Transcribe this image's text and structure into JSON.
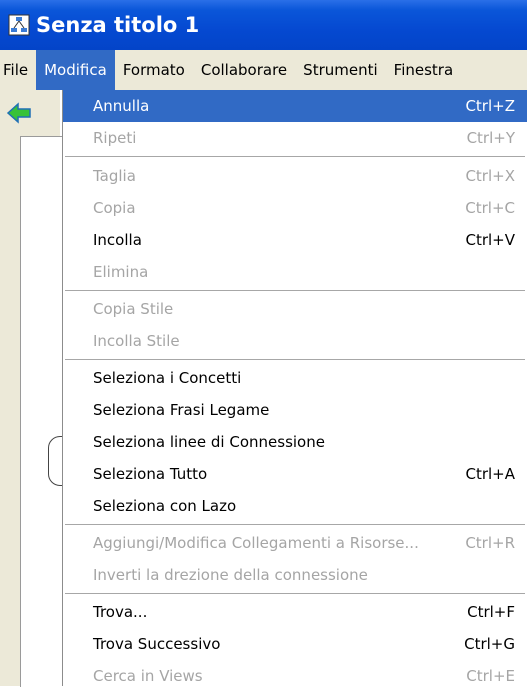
{
  "window": {
    "title": "Senza titolo 1"
  },
  "menubar": {
    "items": [
      "File",
      "Modifica",
      "Formato",
      "Collaborare",
      "Strumenti",
      "Finestra"
    ],
    "active": "Modifica"
  },
  "menu": {
    "items": [
      {
        "label": "Annulla",
        "shortcut": "Ctrl+Z",
        "state": "highlighted"
      },
      {
        "label": "Ripeti",
        "shortcut": "Ctrl+Y",
        "state": "disabled"
      },
      {
        "label": "Taglia",
        "shortcut": "Ctrl+X",
        "state": "disabled"
      },
      {
        "label": "Copia",
        "shortcut": "Ctrl+C",
        "state": "disabled"
      },
      {
        "label": "Incolla",
        "shortcut": "Ctrl+V",
        "state": "enabled"
      },
      {
        "label": "Elimina",
        "shortcut": "",
        "state": "disabled"
      },
      {
        "label": "Copia Stile",
        "shortcut": "",
        "state": "disabled"
      },
      {
        "label": "Incolla Stile",
        "shortcut": "",
        "state": "disabled"
      },
      {
        "label": "Seleziona i Concetti",
        "shortcut": "",
        "state": "enabled"
      },
      {
        "label": "Seleziona Frasi Legame",
        "shortcut": "",
        "state": "enabled"
      },
      {
        "label": "Seleziona linee di Connessione",
        "shortcut": "",
        "state": "enabled"
      },
      {
        "label": "Seleziona Tutto",
        "shortcut": "Ctrl+A",
        "state": "enabled"
      },
      {
        "label": "Seleziona con Lazo",
        "shortcut": "",
        "state": "enabled"
      },
      {
        "label": "Aggiungi/Modifica Collegamenti a Risorse...",
        "shortcut": "Ctrl+R",
        "state": "disabled"
      },
      {
        "label": "Inverti la drezione della connessione",
        "shortcut": "",
        "state": "disabled"
      },
      {
        "label": "Trova...",
        "shortcut": "Ctrl+F",
        "state": "enabled"
      },
      {
        "label": "Trova Successivo",
        "shortcut": "Ctrl+G",
        "state": "enabled"
      },
      {
        "label": "Cerca in Views",
        "shortcut": "Ctrl+E",
        "state": "disabled"
      }
    ]
  },
  "colors": {
    "titlebar": "#0549d1",
    "highlight": "#316ac5",
    "disabled_text": "#a5a5a5",
    "menubar_bg": "#ece9d8"
  }
}
